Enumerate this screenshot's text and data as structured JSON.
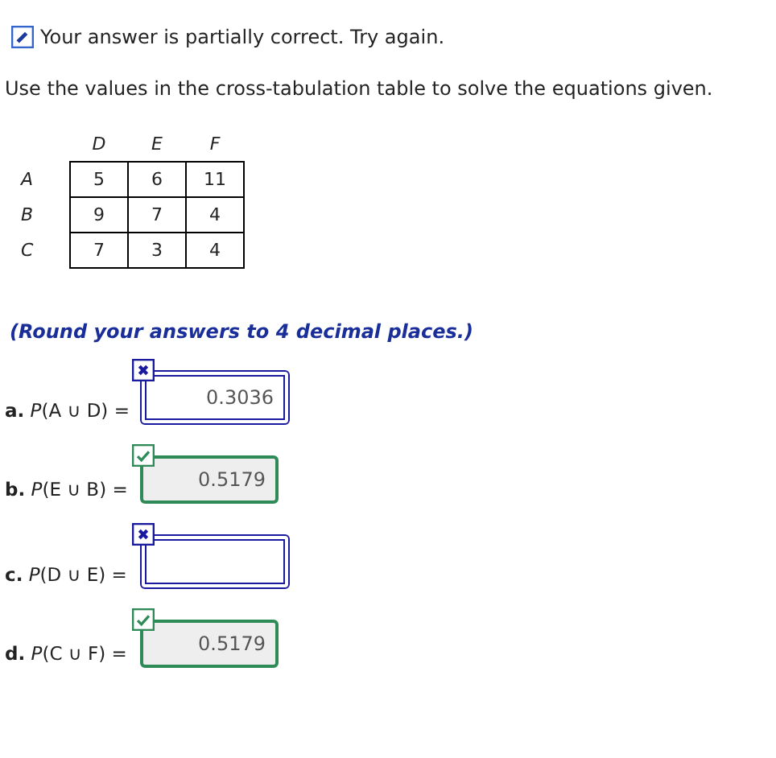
{
  "feedback": {
    "text": "Your answer is partially correct.  Try again."
  },
  "instructions": "Use the values in the cross-tabulation table to solve the equations given.",
  "table": {
    "columns": [
      "D",
      "E",
      "F"
    ],
    "rows": [
      {
        "label": "A",
        "cells": [
          "5",
          "6",
          "11"
        ]
      },
      {
        "label": "B",
        "cells": [
          "9",
          "7",
          "4"
        ]
      },
      {
        "label": "C",
        "cells": [
          "7",
          "3",
          "4"
        ]
      }
    ]
  },
  "rounding_note": "(Round your answers to 4 decimal places.)",
  "questions": [
    {
      "label": "**a.** *P*(A ∪ D) =",
      "value": "0.3036",
      "correct": false
    },
    {
      "label": "**b.** *P*(E ∪ B) =",
      "value": "0.5179",
      "correct": true
    },
    {
      "label": "**c.** *P*(D ∪ E) =",
      "correct": false
    },
    {
      "label": "**d.** *P*(C ∪ F) =",
      "value": "0.5179",
      "correct": true
    }
  ]
}
